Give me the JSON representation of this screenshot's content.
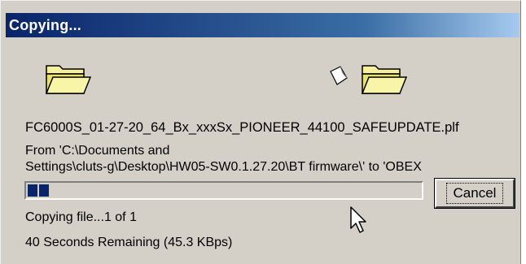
{
  "window": {
    "title": "Copying..."
  },
  "icons": {
    "source": "folder-icon",
    "destination": "folder-icon",
    "transfer": "flying-paper-icon",
    "cursor": "mouse-pointer-icon"
  },
  "transfer": {
    "filename": "FC6000S_01-27-20_64_Bx_xxxSx_PIONEER_44100_SAFEUPDATE.plf",
    "from_line1": "From 'C:\\Documents and",
    "from_line2": "Settings\\cluts-g\\Desktop\\HW05-SW0.1.27.20\\BT firmware\\' to 'OBEX",
    "progress_fraction": 0.08,
    "status": "Copying file...1 of 1",
    "remaining": "40 Seconds Remaining (45.3 KBps)"
  },
  "buttons": {
    "cancel_label": "Cancel"
  },
  "colors": {
    "titlebar_start": "#0a246a",
    "titlebar_end": "#a6caf0",
    "progress_fill": "#0a246a",
    "dialog_bg": "#d4d0c8"
  }
}
